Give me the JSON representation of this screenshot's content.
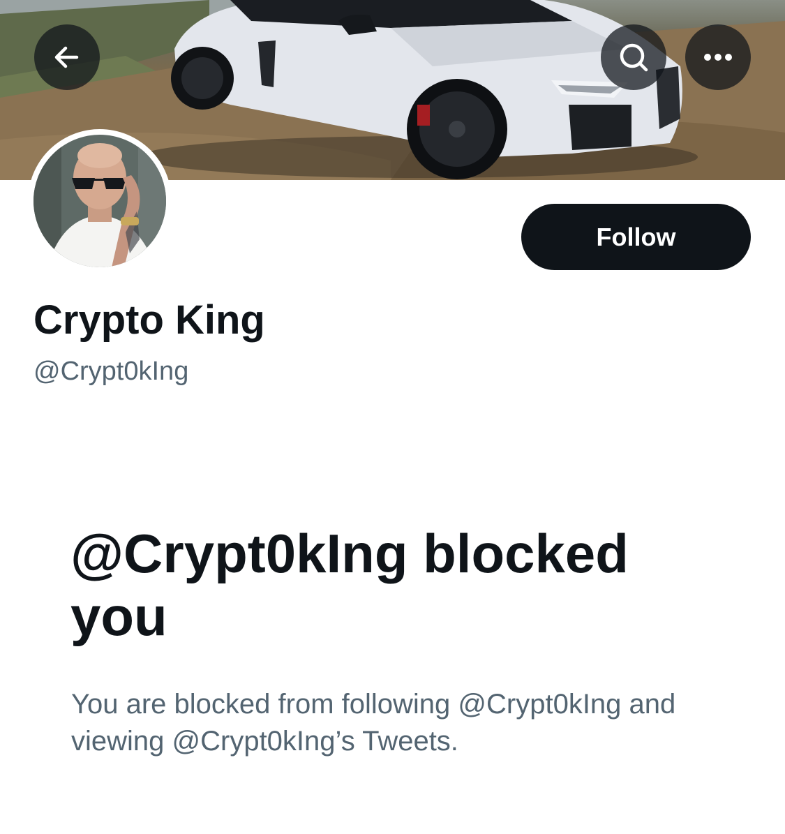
{
  "header": {
    "back_icon": "arrow-left-icon",
    "search_icon": "search-icon",
    "more_icon": "more-horizontal-icon"
  },
  "profile": {
    "display_name": "Crypto King",
    "handle": "@Crypt0kIng",
    "follow_label": "Follow"
  },
  "blocked": {
    "title": "@Crypt0kIng blocked you",
    "description": "You are blocked from following @Crypt0kIng and viewing @Crypt0kIng’s Tweets."
  },
  "colors": {
    "primary_text": "#0f1419",
    "secondary_text": "#536471",
    "button_bg": "#0f1419",
    "button_text": "#ffffff",
    "nav_button_bg": "rgba(15,20,25,0.72)"
  }
}
